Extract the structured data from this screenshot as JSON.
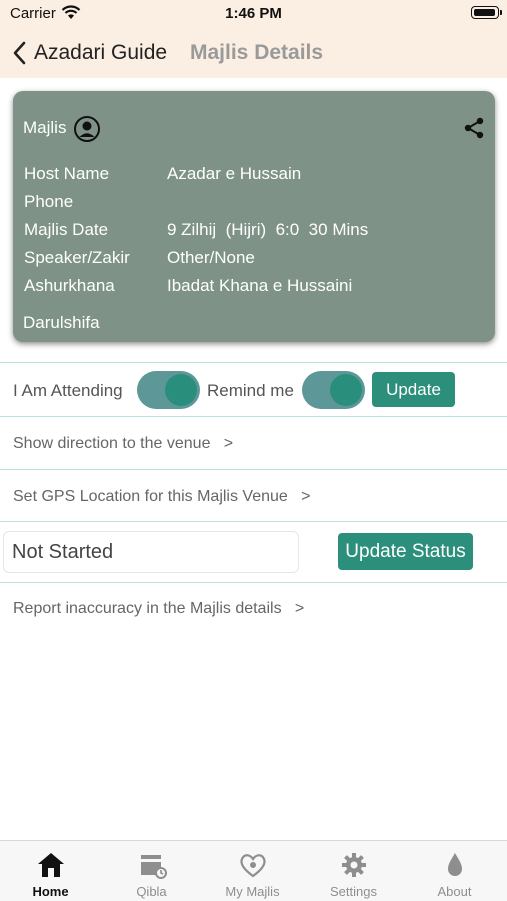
{
  "status_bar": {
    "carrier": "Carrier",
    "time": "1:46 PM"
  },
  "nav": {
    "back_label": "Azadari Guide",
    "title": "Majlis Details"
  },
  "card": {
    "title": "Majlis",
    "rows": [
      {
        "label": "Host Name",
        "value": "Azadar e Hussain"
      },
      {
        "label": "Phone",
        "value": ""
      },
      {
        "label": "Majlis Date",
        "value": "9 Zilhij  (Hijri)  6:0  30 Mins"
      },
      {
        "label": "Speaker/Zakir",
        "value": "Other/None"
      },
      {
        "label": "Ashurkhana",
        "value": "Ibadat Khana e Hussaini"
      }
    ],
    "footer": "Darulshifa"
  },
  "attending": {
    "attending_label": "I Am Attending",
    "attending_on": true,
    "remind_label": "Remind me",
    "remind_on": true,
    "update_label": "Update"
  },
  "links": {
    "directions": "Show direction to the venue   >",
    "gps": "Set GPS Location for this Majlis Venue   >",
    "report": "Report inaccuracy in the Majlis details   >"
  },
  "status": {
    "value": "Not Started",
    "button_label": "Update Status"
  },
  "tabs": [
    {
      "label": "Home",
      "icon": "home-icon",
      "active": true
    },
    {
      "label": "Qibla",
      "icon": "qibla-icon",
      "active": false
    },
    {
      "label": "My Majlis",
      "icon": "heart-icon",
      "active": false
    },
    {
      "label": "Settings",
      "icon": "gear-icon",
      "active": false
    },
    {
      "label": "About",
      "icon": "drop-icon",
      "active": false
    }
  ],
  "colors": {
    "header_bg": "#fbeee2",
    "card_bg": "#7e9287",
    "accent": "#2b8f7b",
    "toggle_track": "#5d9798"
  }
}
